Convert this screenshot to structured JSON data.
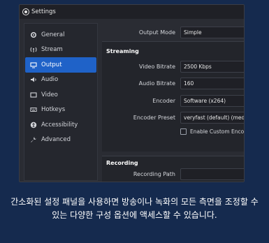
{
  "window": {
    "title": "Settings"
  },
  "sidebar": {
    "items": [
      {
        "label": "General",
        "icon": "gear-icon"
      },
      {
        "label": "Stream",
        "icon": "antenna-icon"
      },
      {
        "label": "Output",
        "icon": "monitor-icon",
        "active": true
      },
      {
        "label": "Audio",
        "icon": "speaker-icon"
      },
      {
        "label": "Video",
        "icon": "screen-icon"
      },
      {
        "label": "Hotkeys",
        "icon": "keyboard-icon"
      },
      {
        "label": "Accessibility",
        "icon": "accessibility-icon"
      },
      {
        "label": "Advanced",
        "icon": "wrench-icon"
      }
    ]
  },
  "output": {
    "mode_label": "Output Mode",
    "mode_value": "Simple",
    "streaming": {
      "title": "Streaming",
      "video_bitrate_label": "Video Bitrate",
      "video_bitrate_value": "2500 Kbps",
      "audio_bitrate_label": "Audio Bitrate",
      "audio_bitrate_value": "160",
      "encoder_label": "Encoder",
      "encoder_value": "Software (x264)",
      "preset_label": "Encoder Preset",
      "preset_value": "veryfast (default) (mediu",
      "custom_label": "Enable Custom Encod"
    },
    "recording": {
      "title": "Recording",
      "path_label": "Recording Path"
    }
  },
  "caption": "간소화된 설정 패널을 사용하면 방송이나 녹화의 모든 측면을 조정할 수 있는 다양한 구성 옵션에 액세스할 수 있습니다."
}
